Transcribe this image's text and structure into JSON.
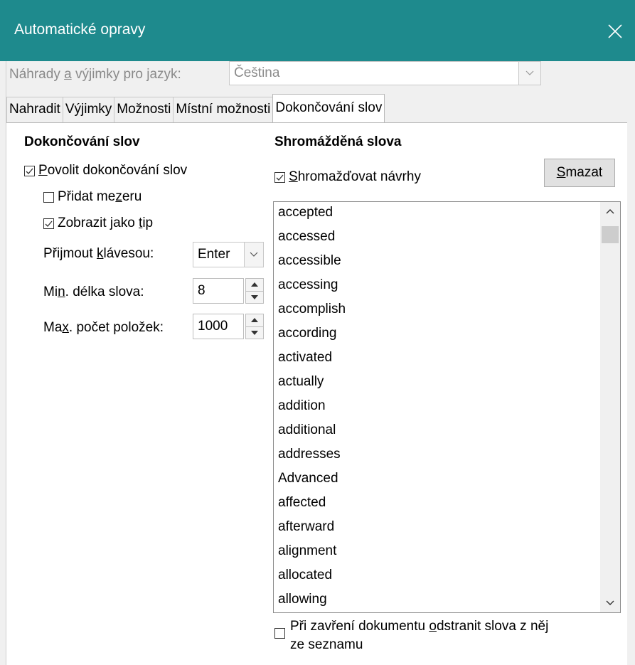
{
  "window": {
    "title": "Automatické opravy"
  },
  "language": {
    "label_pre": "Náhrady ",
    "label_u": "a",
    "label_post": " výjimky pro jazyk:",
    "value": "Čeština"
  },
  "tabs": [
    {
      "label": "Nahradit"
    },
    {
      "label": "Výjimky"
    },
    {
      "label": "Možnosti"
    },
    {
      "label": "Místní možnosti"
    },
    {
      "label": "Dokončování slov"
    }
  ],
  "left": {
    "heading": "Dokončování slov",
    "enable": {
      "pre": "",
      "u": "P",
      "post": "ovolit dokončování slov",
      "checked": true
    },
    "add_space": {
      "pre": "Přidat me",
      "u": "z",
      "post": "eru",
      "checked": false
    },
    "show_tip": {
      "pre": "Zobrazit jako ",
      "u": "t",
      "post": "ip",
      "checked": true
    },
    "accept_key": {
      "pre": "Přijmout ",
      "u": "k",
      "post": "lávesou:",
      "value": "Enter"
    },
    "min_length": {
      "pre": "Mi",
      "u": "n",
      "post": ". délka slova:",
      "value": "8"
    },
    "max_entries": {
      "pre": "Ma",
      "u": "x",
      "post": ". počet položek:",
      "value": "1000"
    }
  },
  "right": {
    "heading": "Shromážděná slova",
    "collect": {
      "pre": "",
      "u": "S",
      "post": "hromažďovat návrhy",
      "checked": true
    },
    "delete_btn": {
      "pre": "",
      "u": "S",
      "post": "mazat"
    },
    "words": [
      "accepted",
      "accessed",
      "accessible",
      "accessing",
      "accomplish",
      "according",
      "activated",
      "actually",
      "addition",
      "additional",
      "addresses",
      "Advanced",
      "affected",
      "afterward",
      "alignment",
      "allocated",
      "allowing"
    ],
    "remove_on_close": {
      "line1_pre": "Při zavření dokumentu ",
      "line1_u": "o",
      "line1_post": "dstranit slova z něj",
      "line2": "ze seznamu",
      "checked": false
    }
  },
  "icons": {
    "close": "close-icon",
    "dropdown": "chevron-down-icon",
    "spin_up": "spin-up-icon",
    "spin_down": "spin-down-icon",
    "scroll_up": "scroll-up-icon",
    "scroll_down": "scroll-down-icon",
    "check": "checkmark-icon"
  },
  "colors": {
    "titlebar": "#1e8a8d",
    "panel": "#ffffff",
    "dialog": "#f0f0f0"
  }
}
